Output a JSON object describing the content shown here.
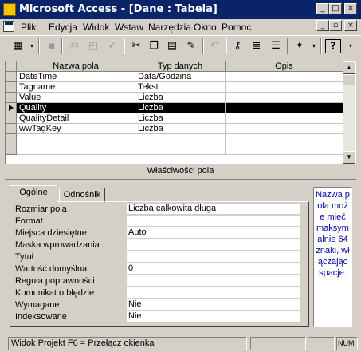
{
  "window": {
    "title": "Microsoft Access - [Dane : Tabela]",
    "controls": [
      "_",
      "□",
      "×"
    ]
  },
  "menu": {
    "items": [
      "Plik",
      "Edycja",
      "Widok",
      "Wstaw",
      "Narzędzia",
      "Okno",
      "Pomoc"
    ],
    "doc_controls": [
      "_",
      "▫",
      "×"
    ]
  },
  "toolbar": {
    "icons": [
      "design-view-icon",
      "save-icon",
      "print-icon",
      "print-preview-icon",
      "spelling-icon",
      "cut-icon",
      "copy-icon",
      "paste-icon",
      "format-painter-icon",
      "undo-icon",
      "primary-key-icon",
      "indexes-icon",
      "insert-rows-icon",
      "delete-rows-icon",
      "build-icon",
      "help-icon"
    ]
  },
  "grid": {
    "columns": [
      "Nazwa pola",
      "Typ danych",
      "Opis"
    ],
    "rows": [
      {
        "name": "DateTime",
        "type": "Data/Godzina",
        "desc": ""
      },
      {
        "name": "Tagname",
        "type": "Tekst",
        "desc": ""
      },
      {
        "name": "Value",
        "type": "Liczba",
        "desc": ""
      },
      {
        "name": "Quality",
        "type": "Liczba",
        "desc": ""
      },
      {
        "name": "QualityDetail",
        "type": "Liczba",
        "desc": ""
      },
      {
        "name": "wwTagKey",
        "type": "Liczba",
        "desc": ""
      }
    ],
    "active_row": 3
  },
  "properties": {
    "title": "Właściwości pola",
    "tabs": [
      "Ogólne",
      "Odnośnik"
    ],
    "active_tab": 0,
    "fields": [
      {
        "label": "Rozmiar pola",
        "value": "Liczba całkowita długa"
      },
      {
        "label": "Format",
        "value": ""
      },
      {
        "label": "Miejsca dziesiętne",
        "value": "Auto"
      },
      {
        "label": "Maska wprowadzania",
        "value": ""
      },
      {
        "label": "Tytuł",
        "value": ""
      },
      {
        "label": "Wartość domyślna",
        "value": "0"
      },
      {
        "label": "Reguła poprawności",
        "value": ""
      },
      {
        "label": "Komunikat o błędzie",
        "value": ""
      },
      {
        "label": "Wymagane",
        "value": "Nie"
      },
      {
        "label": "Indeksowane",
        "value": "Nie"
      }
    ],
    "help_text": "Nazwa pola może mieć maksymalnie 64 znaki, włączając spacje."
  },
  "status": {
    "left": "Widok Projekt  F6 = Przełącz okienka",
    "right": "NUM"
  },
  "colors": {
    "titlebar": "#0a246a",
    "face": "#d4d0c8",
    "help_text": "#0000a8"
  }
}
